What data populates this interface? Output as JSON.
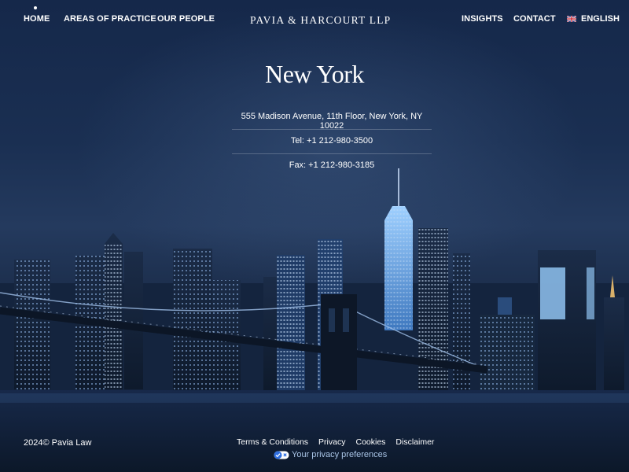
{
  "nav": {
    "home": "HOME",
    "areas": "AREAS OF PRACTICE",
    "people": "OUR PEOPLE",
    "brand": "PAVIA & HARCOURT LLP",
    "insights": "INSIGHTS",
    "contact": "CONTACT",
    "language": "ENGLISH"
  },
  "office": {
    "city": "New York",
    "address": "555 Madison Avenue, 11th Floor, New York, NY 10022",
    "tel": "Tel: +1 212-980-3500",
    "fax": "Fax: +1 212-980-3185"
  },
  "footer": {
    "copyright": "2024© Pavia Law",
    "terms": "Terms & Conditions",
    "privacy": "Privacy",
    "cookies": "Cookies",
    "disclaimer": "Disclaimer",
    "preferences": "Your privacy preferences"
  },
  "icons": {
    "flag": "uk-flag-icon",
    "privacy": "privacy-toggle-icon"
  },
  "colors": {
    "background": "#142640",
    "text": "#ffffff",
    "privacy_link": "#a9c4e6"
  }
}
